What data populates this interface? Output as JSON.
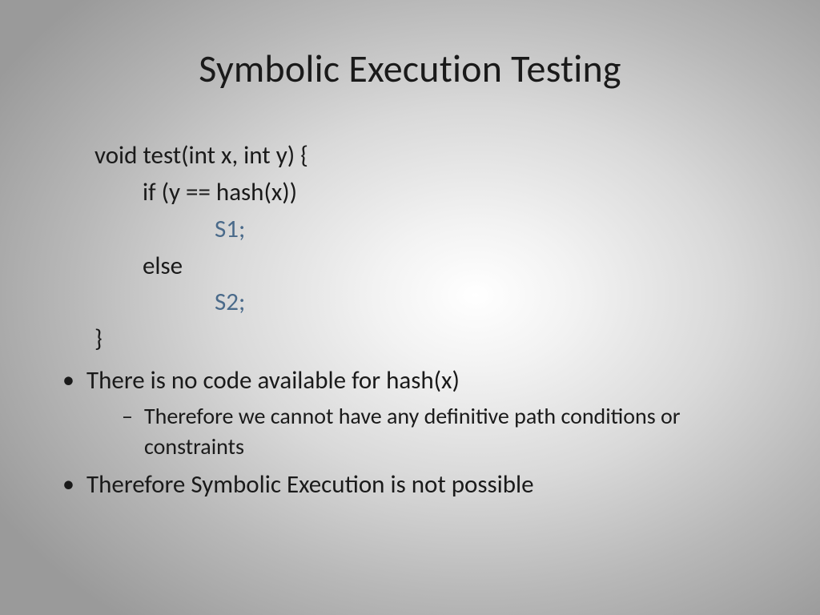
{
  "title": "Symbolic Execution Testing",
  "code": {
    "line1": "void test(int x, int y) {",
    "line2": "if (y == hash(x))",
    "line3": "S1;",
    "line4": "else",
    "line5": "S2;",
    "line6": "}"
  },
  "bullets": {
    "b1": "There is no code available for hash(x)",
    "b1_sub1": "Therefore we cannot have any definitive path conditions or constraints",
    "b2": "Therefore Symbolic Execution is not possible"
  }
}
